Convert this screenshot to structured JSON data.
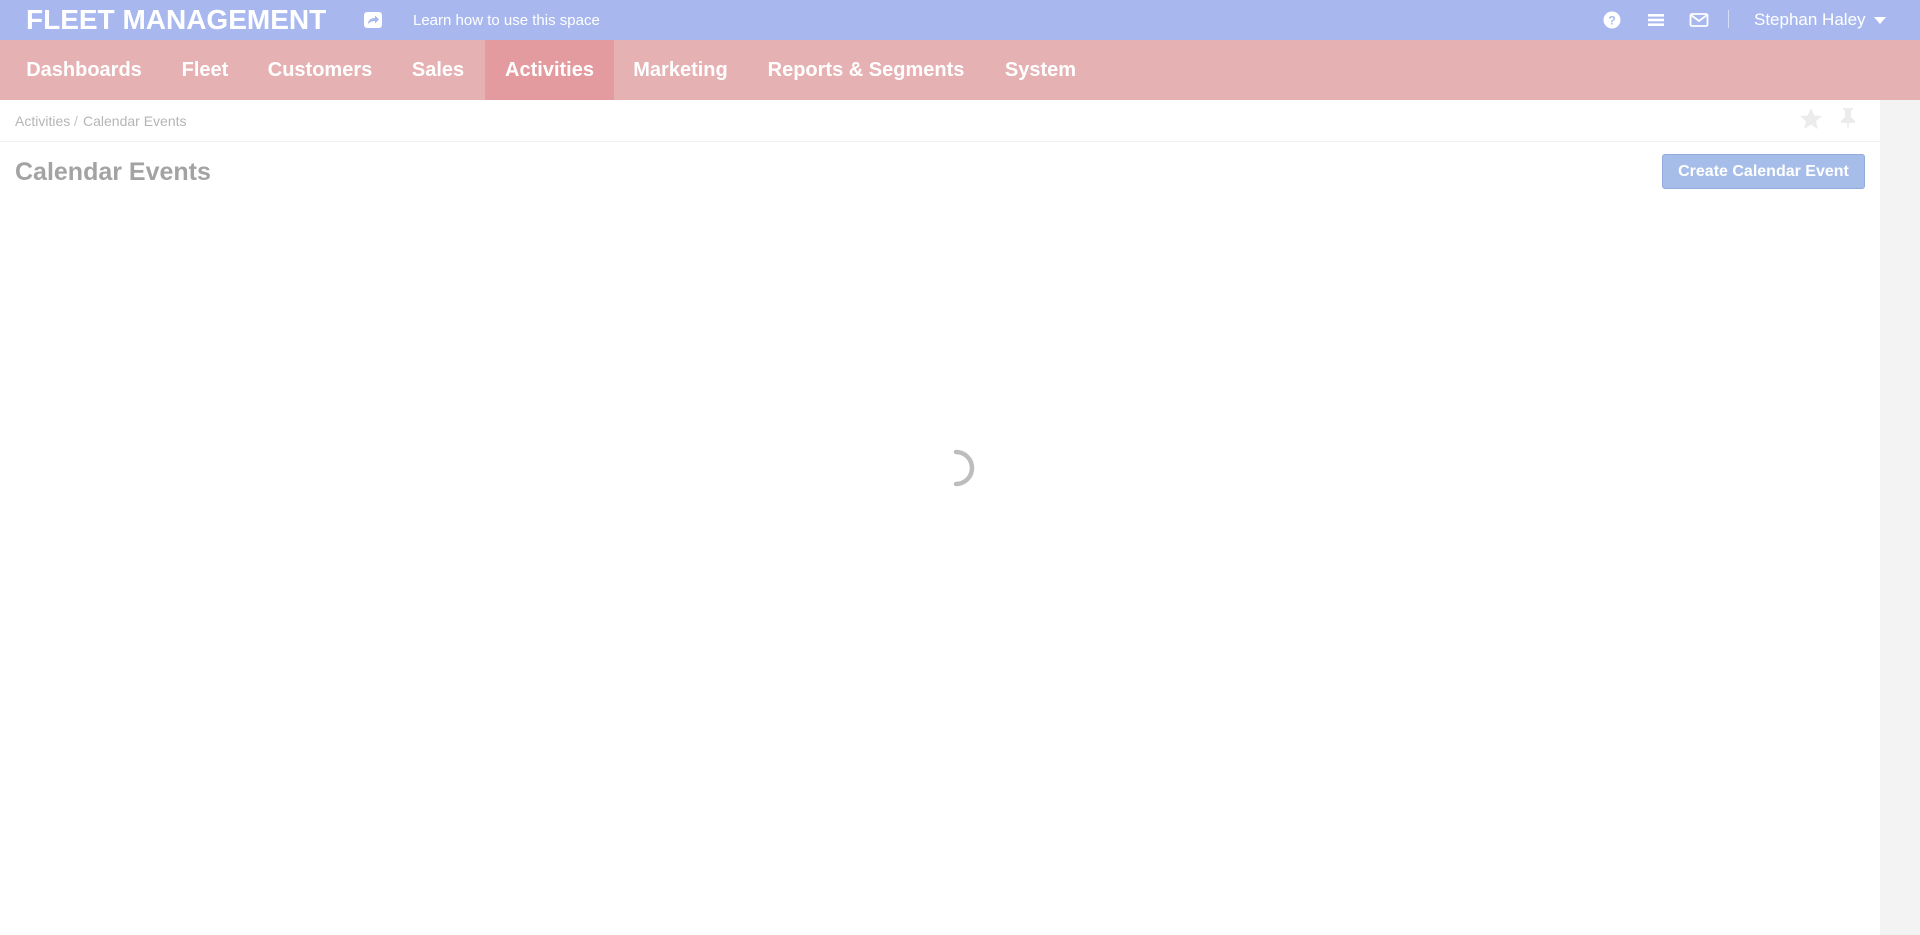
{
  "topbar": {
    "brand": "FLEET MANAGEMENT",
    "learn_link": "Learn how to use this space",
    "user_name": "Stephan Haley",
    "icons": [
      "share-icon",
      "help-icon",
      "menu-icon",
      "mail-icon",
      "caret-down-icon"
    ]
  },
  "nav": {
    "items": [
      {
        "label": "Dashboards"
      },
      {
        "label": "Fleet"
      },
      {
        "label": "Customers"
      },
      {
        "label": "Sales"
      },
      {
        "label": "Activities",
        "active": true
      },
      {
        "label": "Marketing"
      },
      {
        "label": "Reports & Segments"
      },
      {
        "label": "System"
      }
    ]
  },
  "breadcrumb": {
    "items": [
      "Activities",
      "Calendar Events"
    ],
    "separator": "/"
  },
  "page": {
    "title": "Calendar Events",
    "create_button": "Create Calendar Event",
    "loading": true
  },
  "colors": {
    "topbar": "#a8b8ef",
    "nav": "#e6b1b3",
    "nav_active": "#e39b9f",
    "button": "#a7bde9"
  }
}
